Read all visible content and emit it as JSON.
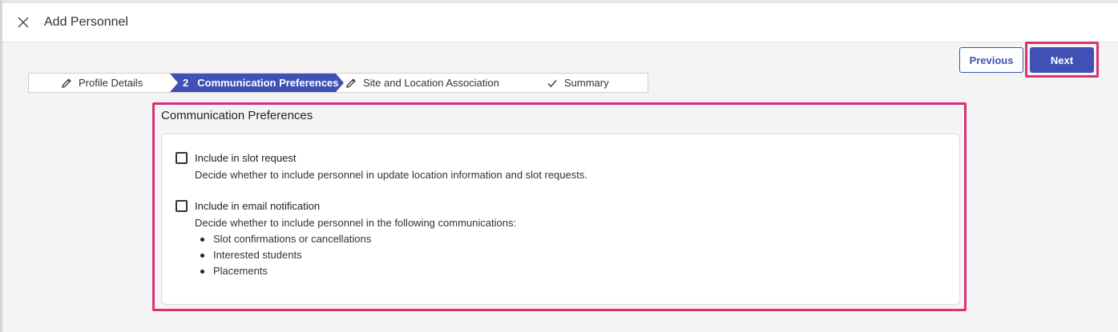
{
  "header": {
    "title": "Add Personnel",
    "close_icon": "close-icon"
  },
  "actions": {
    "previous_label": "Previous",
    "next_label": "Next"
  },
  "stepper": {
    "steps": [
      {
        "label": "Profile Details",
        "icon": "pencil-icon",
        "state": "done"
      },
      {
        "number": "2",
        "label": "Communication Preferences",
        "state": "active"
      },
      {
        "label": "Site and Location Association",
        "icon": "pencil-icon",
        "state": "pending"
      },
      {
        "label": "Summary",
        "icon": "check-icon",
        "state": "pending"
      }
    ]
  },
  "section": {
    "title": "Communication Preferences",
    "options": [
      {
        "label": "Include in slot request",
        "checked": false,
        "description": "Decide whether to include personnel in update location information and slot requests."
      },
      {
        "label": "Include in email notification",
        "checked": false,
        "description": "Decide whether to include personnel in the following communications:",
        "bullets": [
          "Slot confirmations or cancellations",
          "Interested students",
          "Placements"
        ]
      }
    ]
  },
  "colors": {
    "primary": "#3f51b5",
    "highlight": "#d9307a"
  }
}
